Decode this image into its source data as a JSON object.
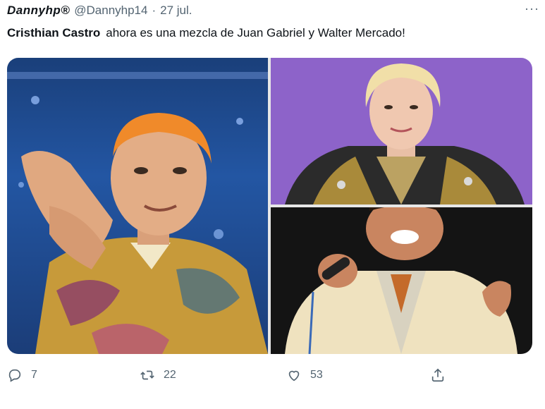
{
  "tweet": {
    "display_name": "Dannyhp®",
    "handle": "@Dannyhp14",
    "separator": "·",
    "time": "27 jul.",
    "more": "···",
    "mention": "Cristhian Castro",
    "text": "ahora es una mezcla de Juan Gabriel y Walter Mercado!"
  },
  "actions": {
    "reply_count": "7",
    "retweet_count": "22",
    "like_count": "53"
  },
  "icons": [
    "reply-icon",
    "retweet-icon",
    "like-icon",
    "share-icon",
    "more-icon"
  ],
  "colors": {
    "text": "#0f1419",
    "secondary": "#536471",
    "purple_bg": "#8d63c9"
  }
}
